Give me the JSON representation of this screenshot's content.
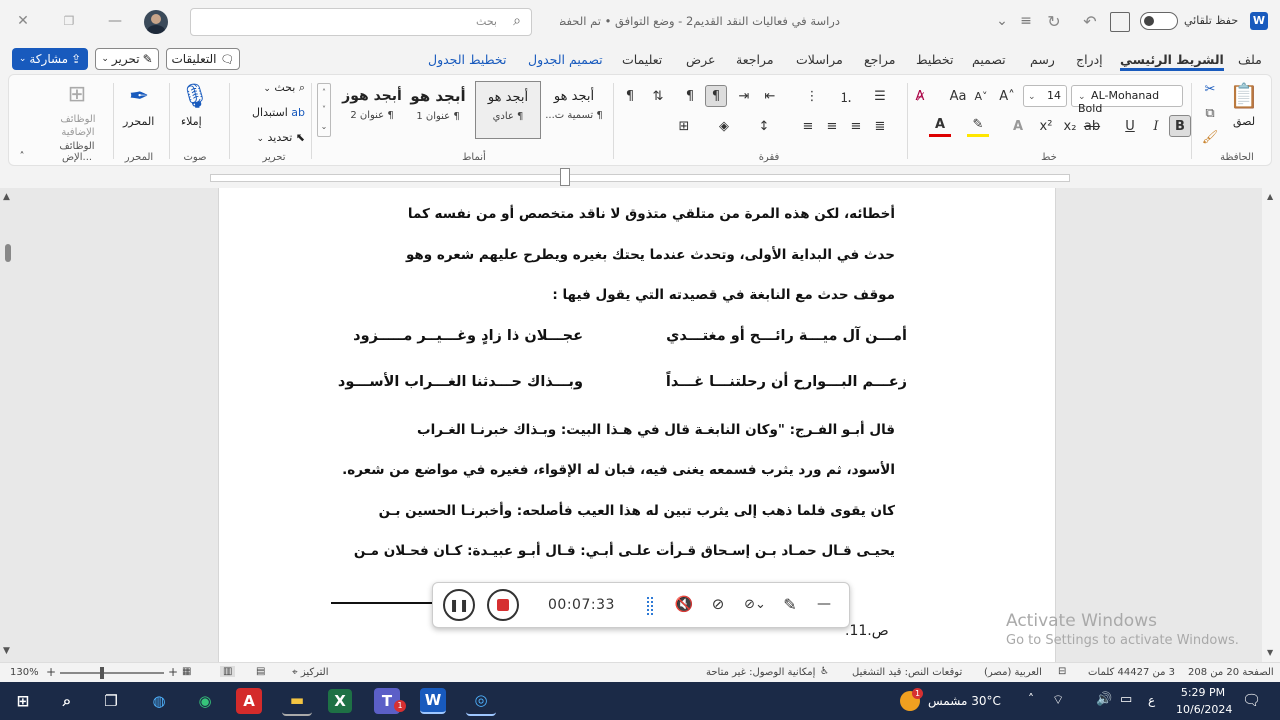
{
  "titlebar": {
    "autosave_label": "حفظ تلقائي",
    "doc_title": "دراسة في فعاليات النقد القديم2 - وضع التوافق • تم الحفظ",
    "search_placeholder": "بحث"
  },
  "tabs": [
    "ملف",
    "الشريط الرئيسي",
    "إدراج",
    "رسم",
    "تصميم",
    "تخطيط",
    "مراجع",
    "مراسلات",
    "مراجعة",
    "عرض",
    "تعليمات",
    "تصميم الجدول",
    "تخطيط الجدول"
  ],
  "actions": {
    "comments": "التعليقات",
    "editing": "تحرير",
    "share": "مشاركة"
  },
  "ribbon": {
    "clipboard": {
      "label": "الحافظة",
      "paste": "لصق"
    },
    "font": {
      "label": "خط",
      "name": "AL-Mohanad Bold",
      "size": "14"
    },
    "paragraph": {
      "label": "فقرة"
    },
    "styles": {
      "label": "أنماط",
      "items": [
        {
          "preview": "أبجد هو",
          "name": "¶ تسمية ت..."
        },
        {
          "preview": "أبجد هو",
          "name": "¶ عادي"
        },
        {
          "preview": "أبجد هو",
          "name": "¶ عنوان 1"
        },
        {
          "preview": "أبجد هوز",
          "name": "¶ عنوان 2"
        }
      ]
    },
    "editing": {
      "label": "تحرير",
      "find": "بحث",
      "replace": "استبدال",
      "select": "تحديد"
    },
    "voice": {
      "label": "صوت",
      "dictate": "إملاء"
    },
    "editor": {
      "label": "المحرر",
      "button": "المحرر"
    },
    "addins": {
      "label": "الوظائف الإض...",
      "button": "الوظائف الإضافية"
    }
  },
  "document": {
    "lines": [
      "أخطائه، لكن هذه المرة من متلقي متذوق لا ناقد متخصص أو من نفسه كما",
      "حدث في البداية الأولى، وتحدث عندما يحتك بغيره ويطرح عليهم شعره وهو",
      "موقف حدث مع النابغة في قصيدته التي يقول فيها :"
    ],
    "verses": [
      {
        "first": "أمـــن آل ميـــة رائـــح أو مغتـــدي",
        "second": "عجـــلان ذا زادٍ وغـــيــر مـــــزود"
      },
      {
        "first": "زعـــم البـــوارح أن رحلتنـــا غـــداً",
        "second": "وبـــذاك حـــدثنا الغـــراب الأســـود"
      }
    ],
    "para2": [
      "قال أبـو الفـرج: \"وكان النابغـة قال في هـذا البيت: وبـذاك خبرنـا الغـراب",
      "الأسود، ثم ورد يثرب فسمعه يغنى فيه، فبان له الإقواء، فغيره في مواضع من شعره.",
      "كان يقوى فلما ذهب إلى يثرب تبين له هذا العيب فأصلحه: وأخبرنـا الحسين بـن",
      "يحيـى قـال حمـاد بـن إسـحاق قـرأت علـى أبـي: قـال أبـو عبيـدة: كـان فحـلان مـن"
    ],
    "footnote": "ص.11."
  },
  "recorder": {
    "time": "00:07:33"
  },
  "watermark": {
    "line1": "Activate Windows",
    "line2": "Go to Settings to activate Windows."
  },
  "statusbar": {
    "page": "الصفحة 20 من 208",
    "words": "3 من 44427 كلمات",
    "language": "العربية (مصر)",
    "predictions": "توقعات النص: قيد التشغيل",
    "accessibility": "إمكانية الوصول: غير متاحة",
    "focus": "التركيز",
    "zoom": "130%"
  },
  "taskbar": {
    "weather": "30°C مشمس",
    "time": "5:29 PM",
    "date": "10/6/2024",
    "lang": "ع",
    "notif": "1"
  }
}
